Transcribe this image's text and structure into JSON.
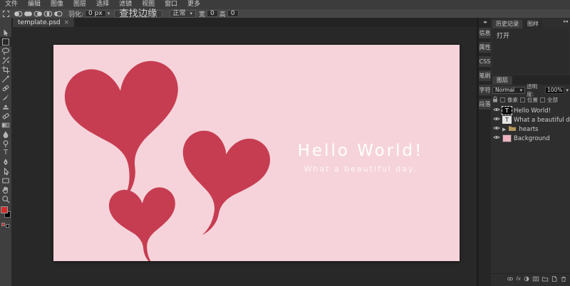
{
  "menu": {
    "items": [
      "文件",
      "编辑",
      "图像",
      "图层",
      "选择",
      "滤镜",
      "视图",
      "窗口",
      "更多"
    ]
  },
  "options": {
    "feather_label": "羽化:",
    "feather_value": "0 px",
    "refine_edge_label": "查找边缘",
    "style_value": "正常",
    "width_label": "宽",
    "width_value": "0",
    "height_label": "高",
    "height_value": "0"
  },
  "document_tab": {
    "title": "template.psd"
  },
  "tools": {
    "type_glyph": "T",
    "names": [
      "move",
      "rect-select",
      "lasso",
      "magic-wand",
      "crop",
      "eyedropper",
      "healing",
      "brush",
      "clone-stamp",
      "eraser",
      "gradient",
      "blur",
      "dodge",
      "type",
      "pen",
      "direct-select",
      "rect-shape",
      "hand",
      "zoom"
    ],
    "selected": "rect-select"
  },
  "canvas": {
    "title": "Hello World!",
    "subtitle": "What a beautiful day.",
    "background_color": "#f6d3da",
    "heart_color": "#c63d52"
  },
  "right_strip": {
    "items": [
      "信息",
      "属性",
      "CSS",
      "笔刷",
      "字符",
      "段落"
    ]
  },
  "history": {
    "tabs": [
      "历史记录",
      "图样"
    ],
    "active_tab": "历史记录",
    "entries": [
      "打开"
    ]
  },
  "layers": {
    "tab_label": "图层",
    "blend_mode": "Normal",
    "opacity_label": "透明度:",
    "opacity_value": "100%",
    "lock_items": [
      "像素",
      "位置",
      "全部"
    ],
    "items": [
      {
        "name": "Hello World!",
        "type": "text",
        "selected": true
      },
      {
        "name": "What a beautiful day.",
        "type": "text",
        "selected": false
      },
      {
        "name": "hearts",
        "type": "group",
        "selected": false
      },
      {
        "name": "Background",
        "type": "background",
        "selected": false
      }
    ]
  },
  "colors": {
    "foreground": "#d22c2c",
    "background": "#000000",
    "layer_thumb_pink": "#efb3c0",
    "heart_red": "#c63d52",
    "canvas_pink": "#f6d3da"
  },
  "icons": {
    "dropdown_arrow": "▾",
    "collapse_tools": "▸◂",
    "collapse_strip": "◂▸",
    "collapse_panel": "▸◂",
    "expander": "▶",
    "close": "×"
  }
}
